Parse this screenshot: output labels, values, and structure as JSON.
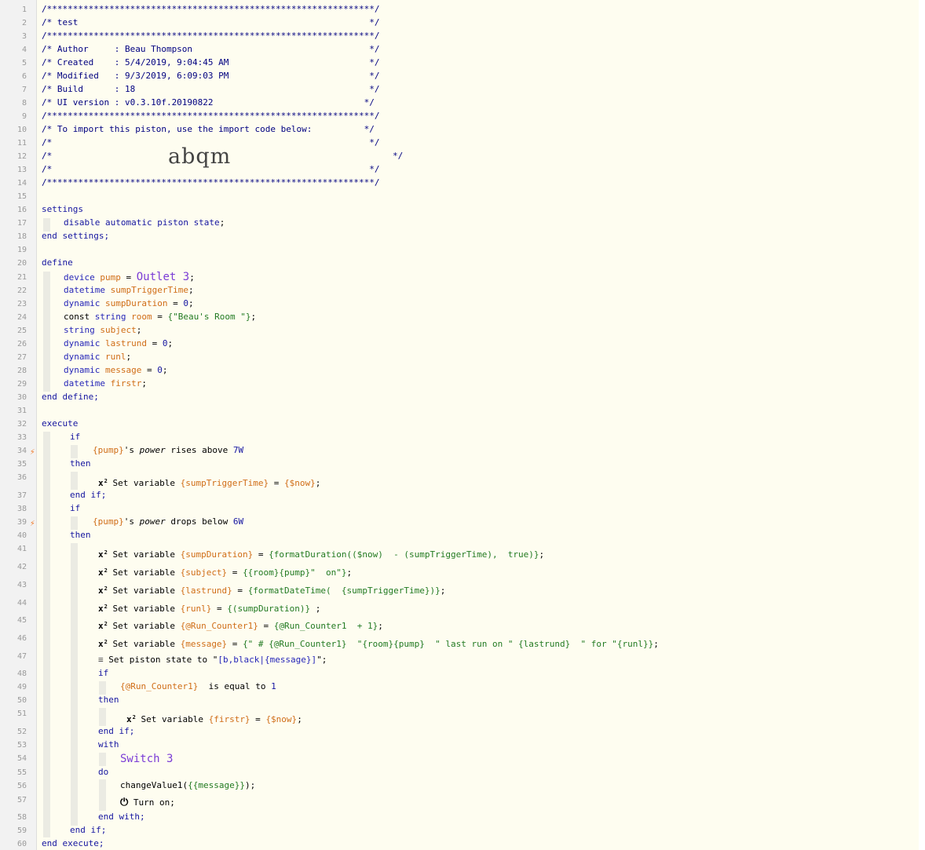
{
  "header": {
    "stars": "/***************************************************************/",
    "title_line": "/* test                                                        */",
    "author_line": "/* Author     : Beau Thompson                                  */",
    "created_line": "/* Created    : 5/4/2019, 9:04:45 AM                           */",
    "modified_line": "/* Modified   : 9/3/2019, 6:09:03 PM                           */",
    "build_line": "/* Build      : 18                                             */",
    "uiversion_line": "/* UI version : v0.3.10f.20190822                             */",
    "import_line": "/* To import this piston, use the import code below:          */",
    "blank_line": "/*                                                             */",
    "code_line_prefix": "/*",
    "code_line_suffix": "*/",
    "import_code": "abqm"
  },
  "settings": {
    "open": "settings",
    "body_kw": "disable automatic piston state",
    "close": "end settings;"
  },
  "define": {
    "open": "define",
    "close": "end define;",
    "pump_type": "device",
    "pump_name": "pump",
    "pump_value": "Outlet 3",
    "trig_type": "datetime",
    "trig_name": "sumpTriggerTime",
    "dur_type": "dynamic",
    "dur_name": "sumpDuration",
    "dur_value": "0",
    "room_kw": "const",
    "room_type": "string",
    "room_name": "room",
    "room_value": "\"Beau's Room \"",
    "subj_type": "string",
    "subj_name": "subject",
    "last_type": "dynamic",
    "last_name": "lastrund",
    "last_value": "0",
    "run_type": "dynamic",
    "run_name": "runl",
    "msg_type": "dynamic",
    "msg_name": "message",
    "msg_value": "0",
    "first_type": "datetime",
    "first_name": "firstr"
  },
  "execute": {
    "open": "execute",
    "close": "end execute;",
    "if": "if",
    "then": "then",
    "end_if": "end if;",
    "with": "with",
    "do": "do",
    "end_with": "end with;",
    "cond1_dev": "{pump}",
    "cond1_attr": "power",
    "cond1_op": "rises above",
    "cond1_val": "7W",
    "cond2_dev": "{pump}",
    "cond2_attr": "power",
    "cond2_op": "drops below",
    "cond2_val": "6W",
    "set_variable": "Set variable",
    "a1_var": "{sumpTriggerTime}",
    "a1_val": "{$now}",
    "a2_var": "{sumpDuration}",
    "a2_val": "{formatDuration(($now)  - (sumpTriggerTime),  true)}",
    "a3_var": "{subject}",
    "a3_val": "{{room}{pump}\"  on\"}",
    "a4_var": "{lastrund}",
    "a4_val": "{formatDateTime(  {sumpTriggerTime})}",
    "a5_var": "{runl}",
    "a5_val": "{(sumpDuration)}",
    "a6_var": "{@Run_Counter1}",
    "a6_val": "{@Run_Counter1  + 1}",
    "a7_var": "{message}",
    "a7_val": "{\" # {@Run_Counter1}  \"{room}{pump}  \" last run on \" {lastrund}  \" for \"{runl}}",
    "a8_label": "Set piston state to",
    "a8_val": "[b,black|{message}]",
    "inner_cond_var": "{@Run_Counter1}",
    "inner_cond_op": "is equal to",
    "inner_cond_val": "1",
    "a9_var": "{firstr}",
    "a9_val": "{$now}",
    "with_device": "Switch 3",
    "change_fn": "changeValue1(",
    "change_arg": "{{message}}",
    "change_end": ");",
    "turn_on": "Turn on;"
  },
  "line_numbers": [
    "1",
    "2",
    "3",
    "4",
    "5",
    "6",
    "7",
    "8",
    "9",
    "10",
    "11",
    "12",
    "13",
    "14",
    "15",
    "16",
    "17",
    "18",
    "19",
    "20",
    "21",
    "22",
    "23",
    "24",
    "25",
    "26",
    "27",
    "28",
    "29",
    "30",
    "31",
    "32",
    "33",
    "34",
    "35",
    "36",
    "37",
    "38",
    "39",
    "40",
    "41",
    "42",
    "43",
    "44",
    "45",
    "46",
    "47",
    "48",
    "49",
    "50",
    "51",
    "52",
    "53",
    "54",
    "55",
    "56",
    "57",
    "58",
    "59",
    "60"
  ]
}
